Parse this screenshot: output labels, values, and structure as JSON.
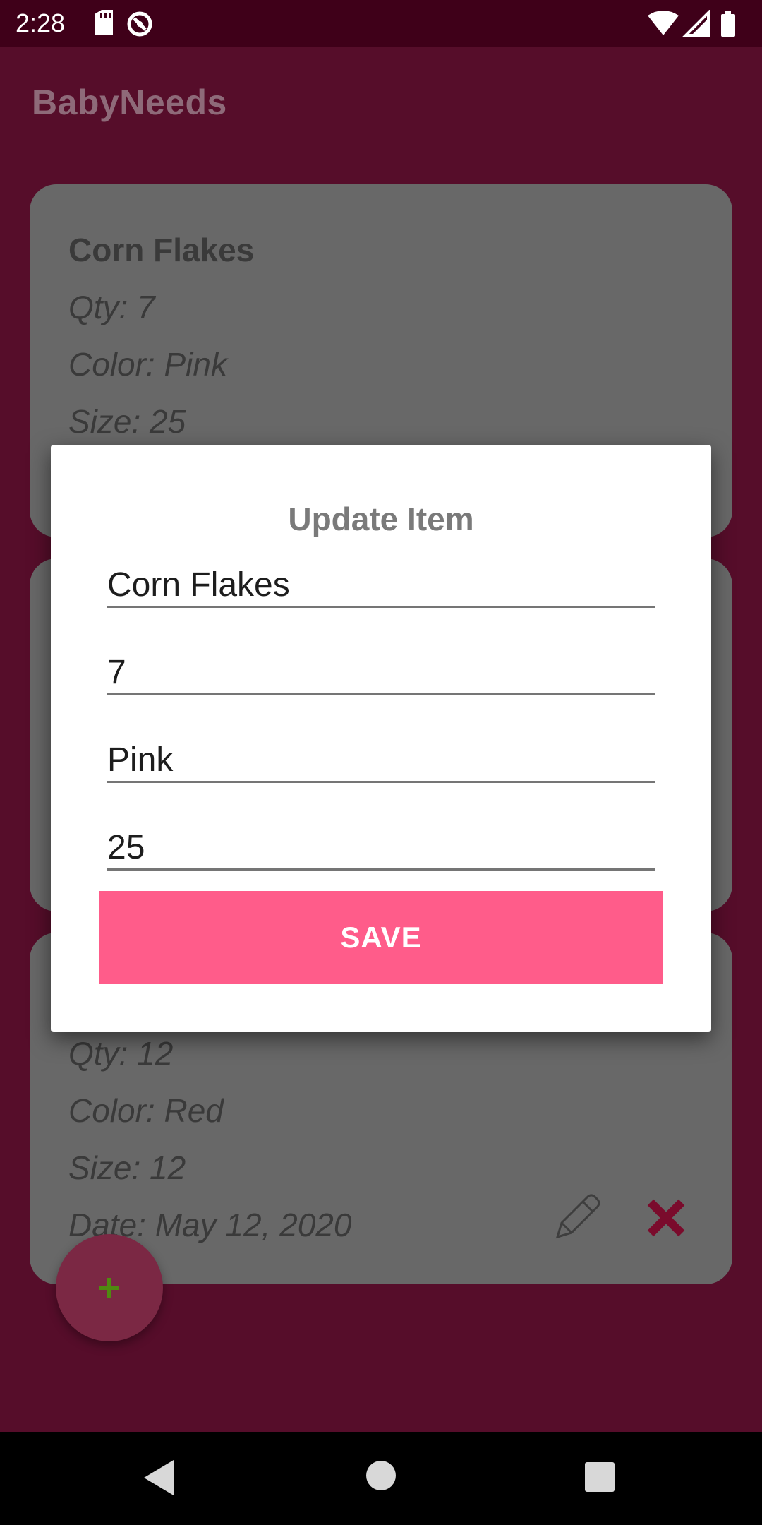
{
  "status_bar": {
    "time": "2:28",
    "icons": [
      "sd-card-icon",
      "sync-icon",
      "wifi-icon",
      "cellular-icon",
      "battery-icon"
    ]
  },
  "app_bar": {
    "title": "BabyNeeds"
  },
  "cards": [
    {
      "title": "Corn Flakes",
      "qty": "Qty: 7",
      "color": "Color: Pink",
      "size": "Size: 25"
    },
    {
      "qty": "Qty: 12",
      "color": "Color: Red",
      "size": "Size: 12",
      "date": "Date: May 12, 2020"
    }
  ],
  "dialog": {
    "title": "Update Item",
    "fields": {
      "name": "Corn Flakes",
      "quantity": "7",
      "color": "Pink",
      "size": "25"
    },
    "save_label": "SAVE"
  },
  "colors": {
    "background": "#560d2a",
    "status_bar": "#3f0019",
    "card": "#686868",
    "save_button": "#ff5c8a",
    "delete_icon": "#7a0b2c",
    "fab_icon": "#4f8a10"
  }
}
